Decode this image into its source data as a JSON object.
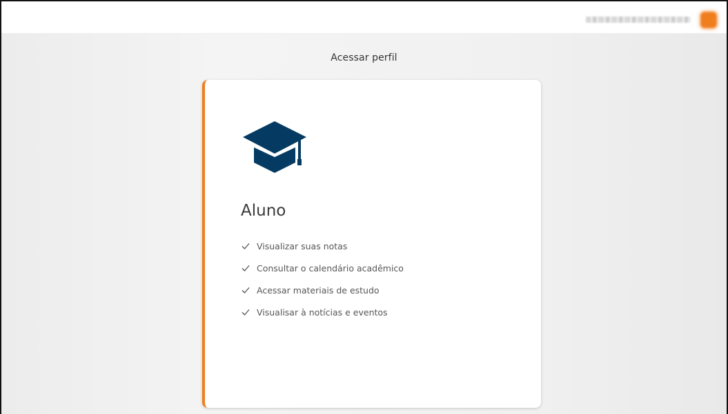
{
  "header": {
    "user_name": "",
    "avatar_color": "#f07e1e"
  },
  "page": {
    "title": "Acessar perfil"
  },
  "profile_card": {
    "icon": "graduation-cap-icon",
    "icon_color": "#053b63",
    "accent_color": "#f07e1e",
    "title": "Aluno",
    "features": [
      "Visualizar suas notas",
      "Consultar o calendário acadêmico",
      "Acessar materiais de estudo",
      "Visualisar à notícias e eventos"
    ]
  }
}
